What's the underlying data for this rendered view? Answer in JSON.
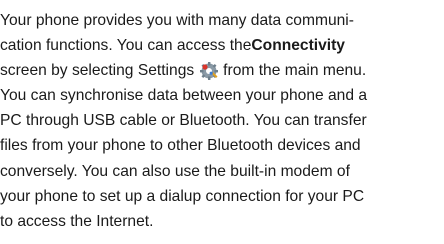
{
  "paragraph": {
    "line1": "Your phone provides you with many data communi-",
    "line2_a": "cation functions. You can access the ",
    "line2_bold": "Connectivity",
    "line3_a": "screen by selecting Settings",
    "line3_b": " from the main menu.",
    "line4": "You can synchronise data between your phone and a",
    "line5": "PC through USB cable or Bluetooth. You can transfer",
    "line6": "files from your phone to other Bluetooth devices and",
    "line7": "conversely. You can also use the built-in modem of",
    "line8": "your phone to set up a dialup connection for your PC",
    "line9": "to access the Internet."
  },
  "icons": {
    "settings": "settings-gear-icon"
  }
}
